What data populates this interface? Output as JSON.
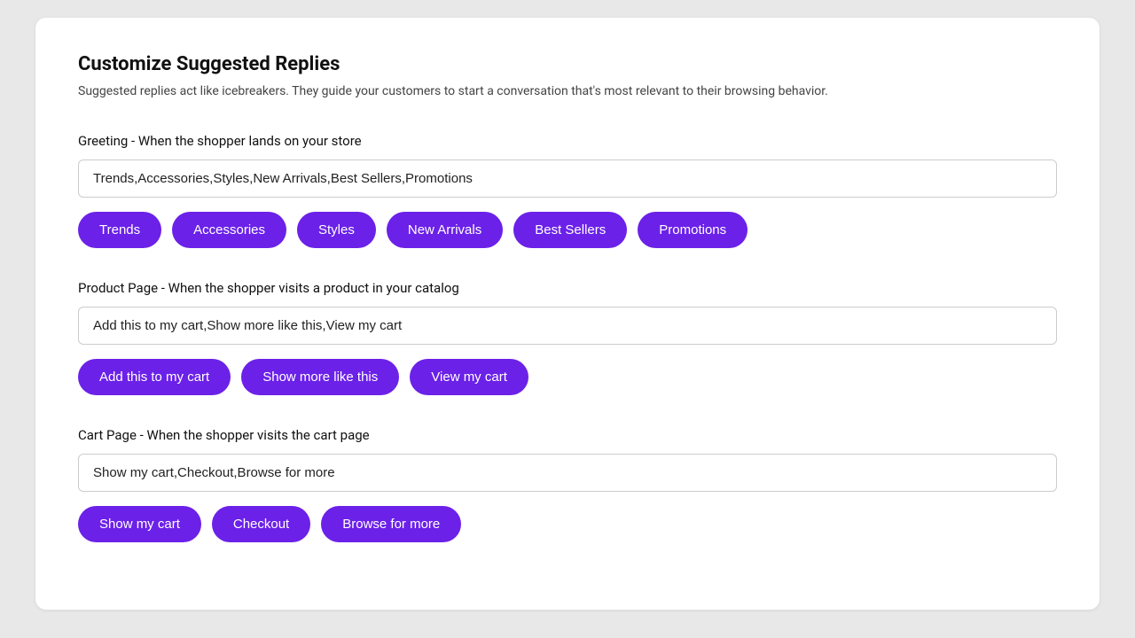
{
  "page": {
    "title": "Customize Suggested Replies",
    "description": "Suggested replies act like icebreakers. They guide your customers to start a conversation that's most relevant to their browsing behavior."
  },
  "sections": [
    {
      "id": "greeting",
      "label": "Greeting - When the shopper lands on your store",
      "input_value": "Trends,Accessories,Styles,New Arrivals,Best Sellers,Promotions",
      "chips": [
        "Trends",
        "Accessories",
        "Styles",
        "New Arrivals",
        "Best Sellers",
        "Promotions"
      ]
    },
    {
      "id": "product-page",
      "label": "Product Page - When the shopper visits a product in your catalog",
      "input_value": "Add this to my cart,Show more like this,View my cart",
      "chips": [
        "Add this to my cart",
        "Show more like this",
        "View my cart"
      ]
    },
    {
      "id": "cart-page",
      "label": "Cart Page - When the shopper visits the cart page",
      "input_value": "Show my cart,Checkout,Browse for more",
      "chips": [
        "Show my cart",
        "Checkout",
        "Browse for more"
      ]
    }
  ]
}
